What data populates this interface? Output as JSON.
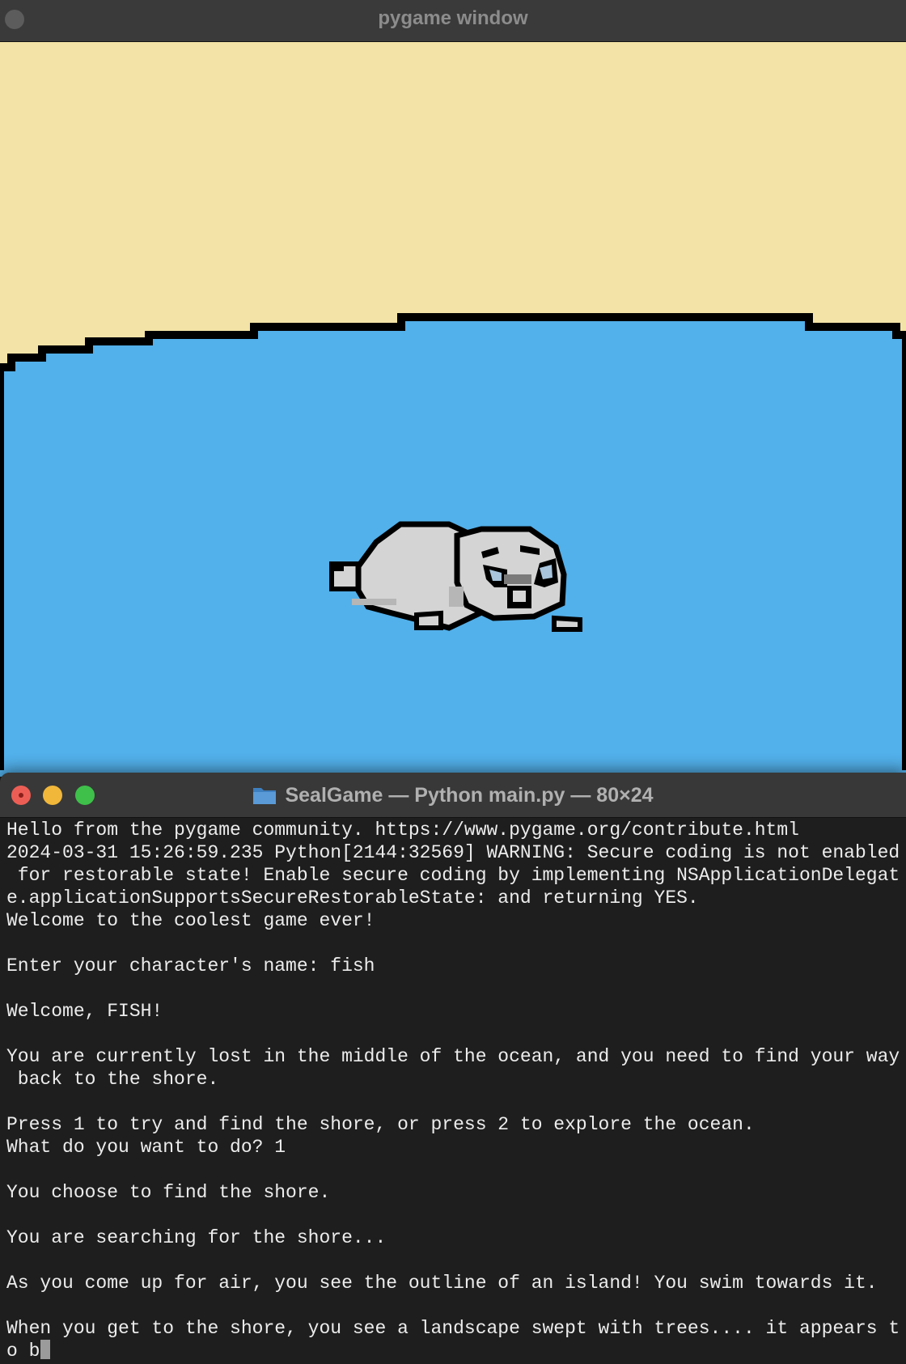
{
  "pygame": {
    "title": "pygame window",
    "sand_color": "#f3e3a6",
    "ocean_color": "#52b0ea",
    "shoreline_color": "#000000",
    "sprite": "seal-pup-icon"
  },
  "terminal": {
    "title": "SealGame — Python main.py — 80×24",
    "folder_icon": "folder-icon",
    "lines": [
      "Hello from the pygame community. https://www.pygame.org/contribute.html",
      "2024-03-31 15:26:59.235 Python[2144:32569] WARNING: Secure coding is not enabled",
      " for restorable state! Enable secure coding by implementing NSApplicationDelegat",
      "e.applicationSupportsSecureRestorableState: and returning YES.",
      "Welcome to the coolest game ever!",
      "",
      "Enter your character's name: fish",
      "",
      "Welcome, FISH!",
      "",
      "You are currently lost in the middle of the ocean, and you need to find your way",
      " back to the shore.",
      "",
      "Press 1 to try and find the shore, or press 2 to explore the ocean.",
      "What do you want to do? 1",
      "",
      "You choose to find the shore.",
      "",
      "You are searching for the shore...",
      "",
      "As you come up for air, you see the outline of an island! You swim towards it.",
      "",
      "When you get to the shore, you see a landscape swept with trees.... it appears t"
    ],
    "prompt_partial": "o b"
  }
}
